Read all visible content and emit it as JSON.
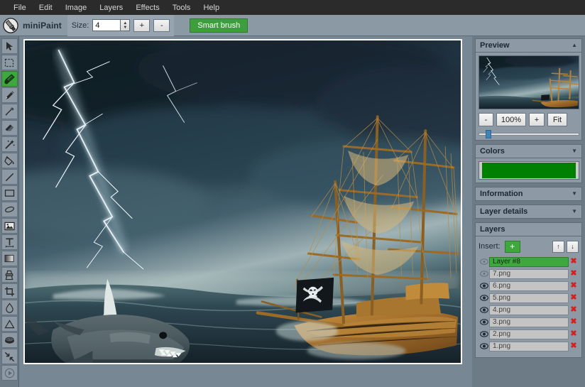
{
  "menubar": {
    "items": [
      {
        "label": "File"
      },
      {
        "label": "Edit"
      },
      {
        "label": "Image"
      },
      {
        "label": "Layers"
      },
      {
        "label": "Effects"
      },
      {
        "label": "Tools"
      },
      {
        "label": "Help"
      }
    ]
  },
  "toolbar": {
    "app_title": "miniPaint",
    "logo_icon": "paintbrush-icon",
    "size_label": "Size:",
    "size_value": "4",
    "plus_label": "+",
    "minus_label": "-",
    "smart_brush_label": "Smart brush",
    "smart_brush_color": "#3e9e3e"
  },
  "tools": [
    {
      "name": "select-arrow-tool",
      "icon": "cursor-arrow-icon",
      "active": false
    },
    {
      "name": "marquee-select-tool",
      "icon": "dashed-rectangle-icon",
      "active": false
    },
    {
      "name": "smart-brush-tool",
      "icon": "brush-icon",
      "active": true
    },
    {
      "name": "pencil-tool",
      "icon": "pencil-icon",
      "active": false
    },
    {
      "name": "eyedropper-tool",
      "icon": "eyedropper-icon",
      "active": false
    },
    {
      "name": "eraser-tool",
      "icon": "eraser-icon",
      "active": false
    },
    {
      "name": "magic-wand-tool",
      "icon": "magic-wand-icon",
      "active": false
    },
    {
      "name": "paint-bucket-tool",
      "icon": "paint-bucket-icon",
      "active": false
    },
    {
      "name": "line-tool",
      "icon": "line-icon",
      "active": false
    },
    {
      "name": "rectangle-tool",
      "icon": "rectangle-icon",
      "active": false
    },
    {
      "name": "ellipse-tool",
      "icon": "ellipse-icon",
      "active": false
    },
    {
      "name": "insert-image-tool",
      "icon": "image-icon",
      "active": false
    },
    {
      "name": "text-tool",
      "icon": "text-t-icon",
      "active": false
    },
    {
      "name": "gradient-tool",
      "icon": "gradient-icon",
      "active": false
    },
    {
      "name": "clone-stamp-tool",
      "icon": "stamp-icon",
      "active": false
    },
    {
      "name": "crop-tool",
      "icon": "crop-icon",
      "active": false
    },
    {
      "name": "blur-tool",
      "icon": "water-drop-icon",
      "active": false
    },
    {
      "name": "sharpen-tool",
      "icon": "triangle-icon",
      "active": false
    },
    {
      "name": "smudge-tool",
      "icon": "sponge-icon",
      "active": false
    },
    {
      "name": "shrink-tool",
      "icon": "arrows-inward-icon",
      "active": false
    },
    {
      "name": "play-tool",
      "icon": "play-circle-icon",
      "active": false
    }
  ],
  "preview": {
    "title": "Preview",
    "collapse_icon": "chevron-up-icon",
    "zoom_out_label": "-",
    "zoom_level_label": "100%",
    "zoom_in_label": "+",
    "fit_label": "Fit"
  },
  "colors": {
    "title": "Colors",
    "collapse_icon": "chevron-down-icon",
    "selected_color": "#008000"
  },
  "information": {
    "title": "Information",
    "collapse_icon": "chevron-down-icon"
  },
  "layer_details": {
    "title": "Layer details",
    "collapse_icon": "chevron-down-icon"
  },
  "layers": {
    "title": "Layers",
    "insert_label": "Insert:",
    "insert_button_label": "+",
    "move_up_label": "↑",
    "move_down_label": "↓",
    "delete_label": "✖",
    "items": [
      {
        "name": "Layer #8",
        "visible": false,
        "selected": true
      },
      {
        "name": "7.png",
        "visible": false,
        "selected": false
      },
      {
        "name": "6.png",
        "visible": true,
        "selected": false
      },
      {
        "name": "5.png",
        "visible": true,
        "selected": false
      },
      {
        "name": "4.png",
        "visible": true,
        "selected": false
      },
      {
        "name": "3.png",
        "visible": true,
        "selected": false
      },
      {
        "name": "2.png",
        "visible": true,
        "selected": false
      },
      {
        "name": "1.png",
        "visible": true,
        "selected": false
      }
    ]
  },
  "canvas": {
    "description": "Stormy sea scene with lightning bolts, a great white shark, and a pirate ship flying a Jolly Roger flag"
  }
}
